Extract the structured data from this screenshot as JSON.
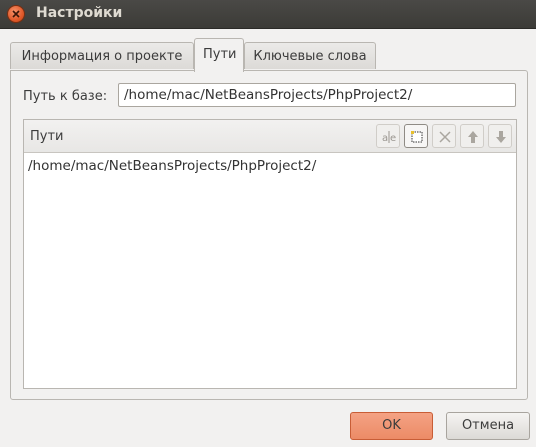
{
  "window": {
    "title": "Настройки"
  },
  "tabs": [
    {
      "label": "Информация о проекте",
      "active": false
    },
    {
      "label": "Пути",
      "active": true
    },
    {
      "label": "Ключевые слова",
      "active": false
    }
  ],
  "base_path": {
    "label": "Путь к базе:",
    "value": "/home/mac/NetBeansProjects/PhpProject2/"
  },
  "paths": {
    "header": "Пути",
    "toolbar": [
      "rename-icon",
      "new-folder-icon",
      "delete-icon",
      "move-up-icon",
      "move-down-icon"
    ],
    "items": [
      "/home/mac/NetBeansProjects/PhpProject2/"
    ]
  },
  "buttons": {
    "ok": "OK",
    "cancel": "Отмена"
  },
  "colors": {
    "titlebar": "#3c3b37",
    "accent": "#ec8b66",
    "close": "#e1592a"
  }
}
